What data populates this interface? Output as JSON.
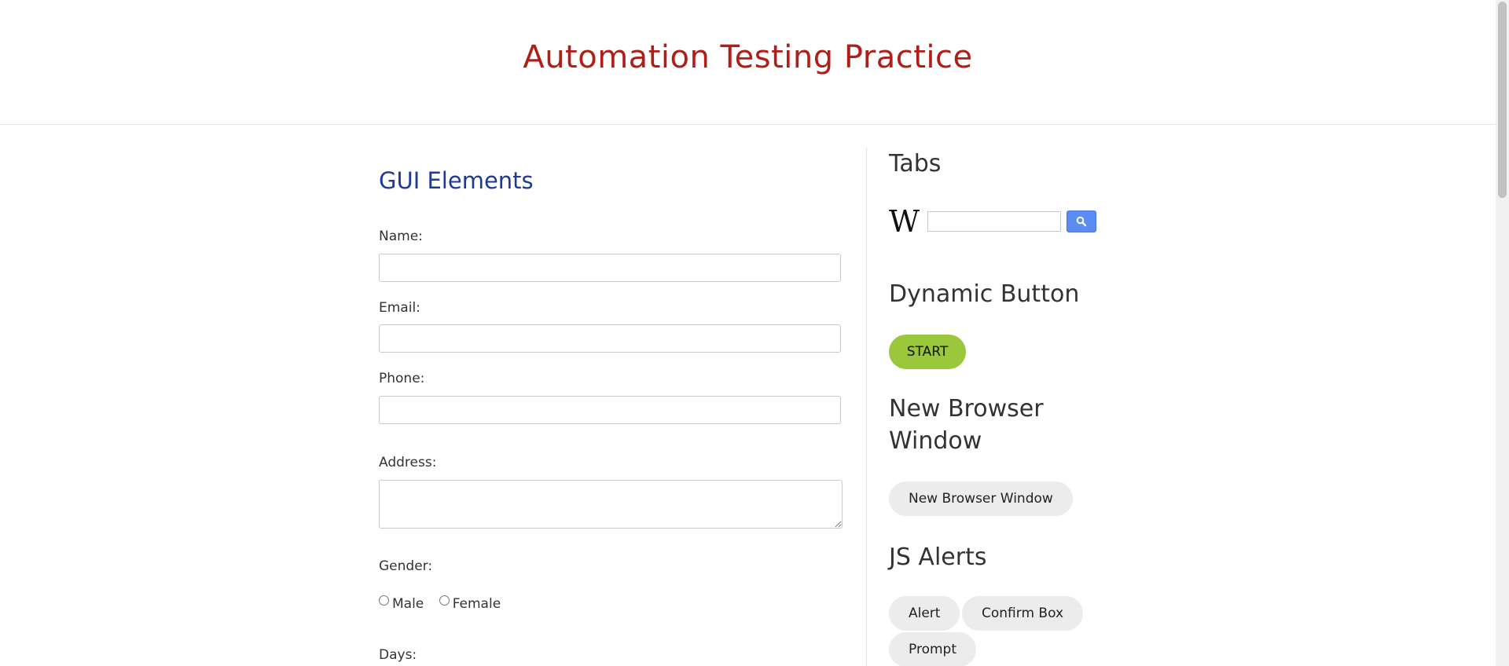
{
  "header": {
    "title": "Automation Testing Practice"
  },
  "gui": {
    "title": "GUI Elements",
    "name_label": "Name:",
    "email_label": "Email:",
    "phone_label": "Phone:",
    "address_label": "Address:",
    "gender_label": "Gender:",
    "gender_options": [
      "Male",
      "Female"
    ],
    "days_label": "Days:"
  },
  "tabs": {
    "title": "Tabs",
    "wiki_logo": "W",
    "search_icon": "search-icon"
  },
  "dynamic": {
    "title": "Dynamic Button",
    "start_label": "START"
  },
  "new_window": {
    "title": "New Browser Window",
    "button_label": "New Browser Window"
  },
  "alerts": {
    "title": "JS Alerts",
    "buttons": [
      "Alert",
      "Confirm Box",
      "Prompt"
    ]
  },
  "colors": {
    "header_title": "#b01e18",
    "gui_title": "#1f3a93",
    "start_button": "#9ac73b",
    "wiki_search_button": "#5b8cf1"
  }
}
